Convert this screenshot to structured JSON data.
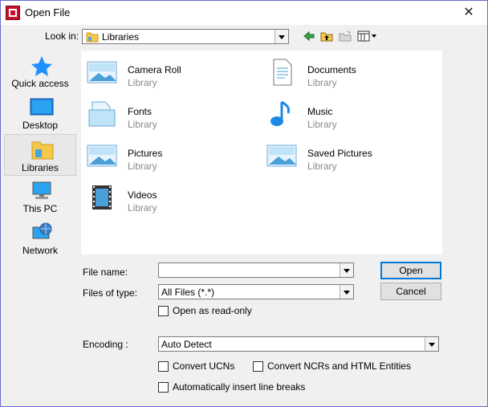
{
  "window": {
    "title": "Open File",
    "close_glyph": "✕"
  },
  "lookin": {
    "label": "Look in:",
    "value": "Libraries"
  },
  "places": [
    {
      "label": "Quick access",
      "icon": "quick-access-star-icon"
    },
    {
      "label": "Desktop",
      "icon": "desktop-icon"
    },
    {
      "label": "Libraries",
      "icon": "libraries-folder-icon",
      "selected": true
    },
    {
      "label": "This PC",
      "icon": "computer-icon"
    },
    {
      "label": "Network",
      "icon": "network-globe-icon"
    }
  ],
  "files": [
    {
      "name": "Camera Roll",
      "sub": "Library",
      "icon": "pictures-library-icon"
    },
    {
      "name": "Documents",
      "sub": "Library",
      "icon": "documents-library-icon"
    },
    {
      "name": "Fonts",
      "sub": "Library",
      "icon": "fonts-library-icon"
    },
    {
      "name": "Music",
      "sub": "Library",
      "icon": "music-library-icon"
    },
    {
      "name": "Pictures",
      "sub": "Library",
      "icon": "pictures-library-icon"
    },
    {
      "name": "Saved Pictures",
      "sub": "Library",
      "icon": "pictures-library-icon"
    },
    {
      "name": "Videos",
      "sub": "Library",
      "icon": "videos-library-icon"
    }
  ],
  "form": {
    "filename_label": "File name:",
    "filename_value": "",
    "filetype_label": "Files of type:",
    "filetype_value": "All Files (*.*)",
    "readonly_label": "Open as read-only",
    "encoding_label": "Encoding :",
    "encoding_value": "Auto Detect",
    "convert_ucns_label": "Convert UCNs",
    "convert_ncrs_label": "Convert NCRs and HTML Entities",
    "auto_breaks_label": "Automatically insert line breaks"
  },
  "buttons": {
    "open": "Open",
    "cancel": "Cancel"
  },
  "colors": {
    "accent": "#0078d7",
    "folder": "#f6c84a",
    "border": "#6b6bd6"
  }
}
